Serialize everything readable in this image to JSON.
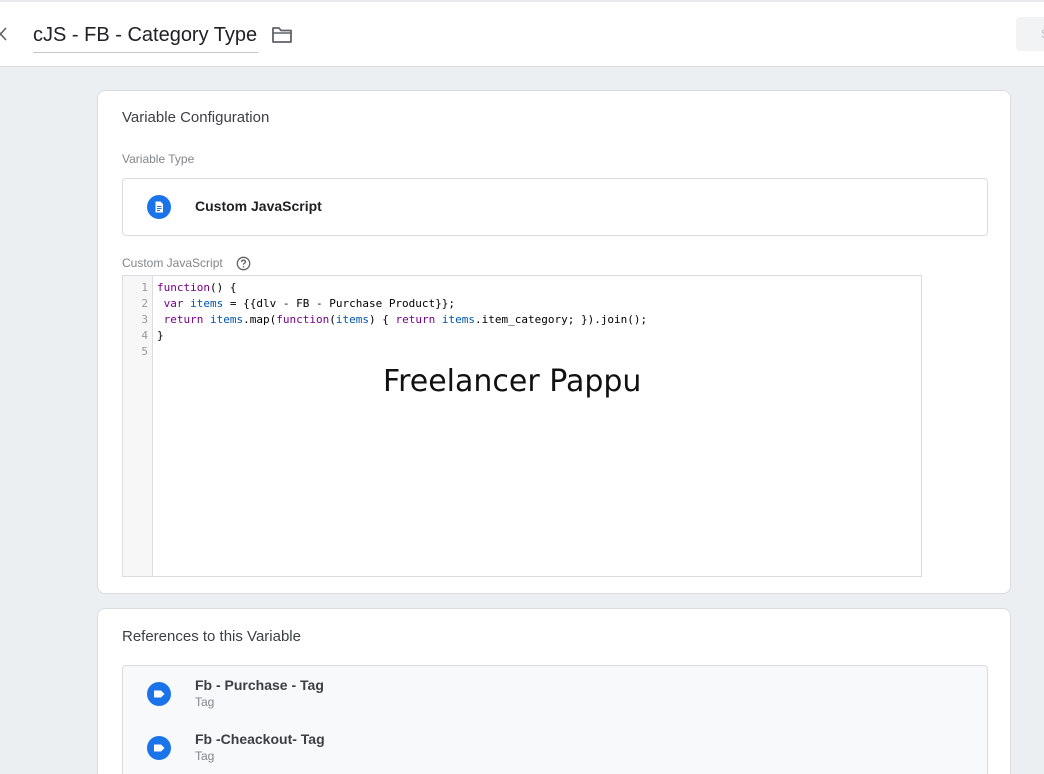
{
  "header": {
    "title": "cJS - FB - Category Type",
    "close_icon": "close-icon",
    "folder_icon": "folder-icon",
    "save_label": "S"
  },
  "variable_configuration": {
    "title": "Variable Configuration",
    "type_label": "Variable Type",
    "type_value": "Custom JavaScript",
    "type_icon": "document-icon",
    "code_label": "Custom JavaScript",
    "help_icon": "help-icon",
    "code_lines": [
      {
        "num": "1",
        "text": "function() {"
      },
      {
        "num": "2",
        "text": " var items = {{dlv - FB - Purchase Product}};"
      },
      {
        "num": "3",
        "text": " return items.map(function(items) { return items.item_category; }).join();"
      },
      {
        "num": "4",
        "text": "}"
      },
      {
        "num": "5",
        "text": ""
      }
    ],
    "watermark": "Freelancer Pappu"
  },
  "references": {
    "title": "References to this Variable",
    "items": [
      {
        "name": "Fb - Purchase - Tag",
        "type": "Tag",
        "icon": "tag-icon"
      },
      {
        "name": "Fb -Cheackout- Tag",
        "type": "Tag",
        "icon": "tag-icon"
      }
    ]
  },
  "colors": {
    "accent_blue": "#1a73e8",
    "background": "#eceff1",
    "keyword": "#770088",
    "variable": "#0055aa"
  }
}
